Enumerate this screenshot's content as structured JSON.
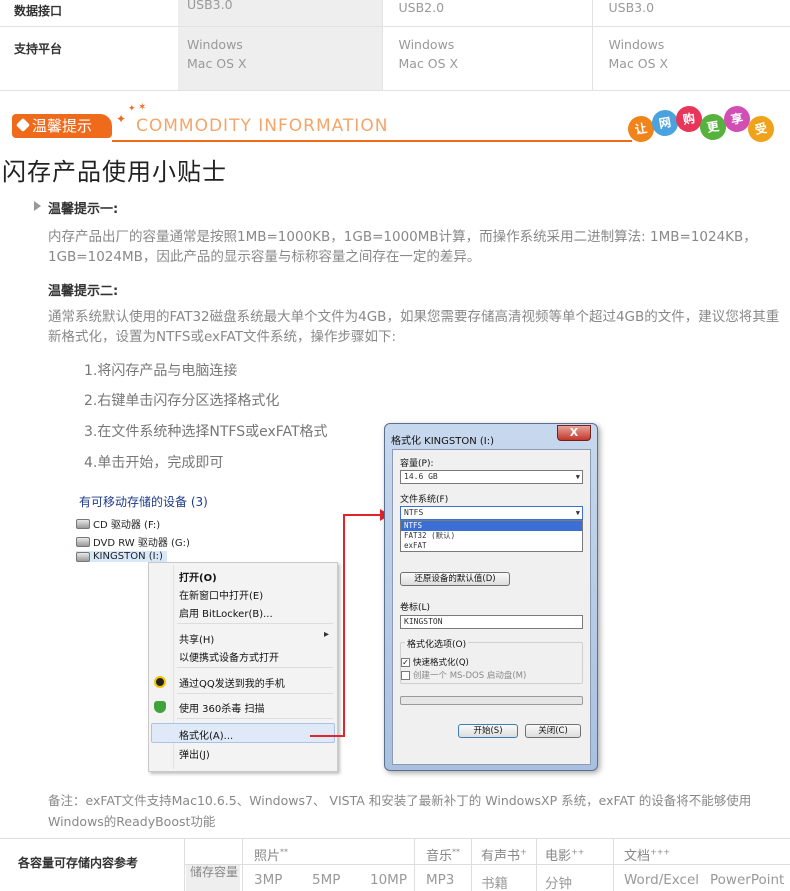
{
  "spec": {
    "rows": [
      {
        "label": "数据接口",
        "values": [
          "USB3.0",
          "USB2.0",
          "USB3.0"
        ]
      },
      {
        "label": "支持平台",
        "values": [
          [
            "Windows",
            "Mac OS X"
          ],
          [
            "Windows",
            "Mac OS X"
          ],
          [
            "Windows",
            "Mac OS X"
          ]
        ]
      }
    ]
  },
  "banner": {
    "tag": "温馨提示",
    "english": "COMMODITY  INFORMATION",
    "bubbles": [
      "让",
      "网",
      "购",
      "更",
      "享",
      "受"
    ],
    "bubble_colors": [
      "#f0841b",
      "#4aa3df",
      "#e8365a",
      "#56b23c",
      "#d14fb4",
      "#f0a21b"
    ]
  },
  "heading": "闪存产品使用小贴士",
  "tip1": {
    "title": "温馨提示一:",
    "text": "内存产品出厂的容量通常是按照1MB=1000KB，1GB=1000MB计算，而操作系统采用二进制算法: 1MB=1024KB，1GB=1024MB，因此产品的显示容量与标称容量之间存在一定的差异。"
  },
  "tip2": {
    "title": "温馨提示二:",
    "text": "通常系统默认使用的FAT32磁盘系统最大单个文件为4GB，如果您需要存储高清视频等单个超过4GB的文件，建议您将其重新格式化，设置为NTFS或exFAT文件系统，操作步骤如下:",
    "steps": [
      "1.将闪存产品与电脑连接",
      "2.右键单击闪存分区选择格式化",
      "3.在文件系统种选择NTFS或exFAT格式",
      "4.单击开始，完成即可"
    ]
  },
  "explorer": {
    "header": "有可移动存储的设备 (3)",
    "drives": [
      "CD 驱动器 (F:)",
      "DVD RW 驱动器 (G:)",
      "KINGSTON (I:)"
    ],
    "menu": {
      "open": "打开(O)",
      "open_new": "在新窗口中打开(E)",
      "bitlocker": "启用 BitLocker(B)...",
      "share": "共享(H)",
      "share_arrow": "▸",
      "portable": "以便携式设备方式打开",
      "qq": "通过QQ发送到我的手机",
      "scan": "使用 360杀毒 扫描",
      "format": "格式化(A)...",
      "eject": "弹出(J)"
    }
  },
  "dialog": {
    "title": "格式化 KINGSTON (I:)",
    "close": "X",
    "capacity_label": "容量(P):",
    "capacity_value": "14.6 GB",
    "fs_label": "文件系统(F)",
    "fs_value": "NTFS",
    "fs_options": [
      "NTFS",
      "FAT32 (默认)",
      "exFAT"
    ],
    "restore_button": "还原设备的默认值(D)",
    "volume_label": "卷标(L)",
    "volume_value": "KINGSTON",
    "options_label": "格式化选项(O)",
    "quick_format": "快速格式化(Q)",
    "quick_format_check": "✓",
    "msdos": "创建一个 MS-DOS 启动盘(M)",
    "start_button": "开始(S)",
    "close_button": "关闭(C)"
  },
  "note": "备注：exFAT文件支持Mac10.6.5、Windows7、  VISTA  和安装了最新补丁的 WindowsXP 系统，exFAT 的设备将不能够使用Windows的ReadyBoost功能",
  "capacity": {
    "label": "各容量可存储内容参考",
    "row_label": "储存容量",
    "headers": [
      {
        "text": "照片",
        "sup": "**"
      },
      {
        "text": "音乐",
        "sup": "**"
      },
      {
        "text": "有声书",
        "sup": "+"
      },
      {
        "text": "电影",
        "sup": "++"
      },
      {
        "text": "文档",
        "sup": "+++"
      }
    ],
    "values": [
      "3MP",
      "5MP",
      "10MP",
      "MP3",
      "书籍",
      "分钟",
      "Word/Excel",
      "PowerPoint"
    ]
  },
  "colors": {
    "accent": "#f06a1b",
    "arrow_red": "#e0252b"
  }
}
